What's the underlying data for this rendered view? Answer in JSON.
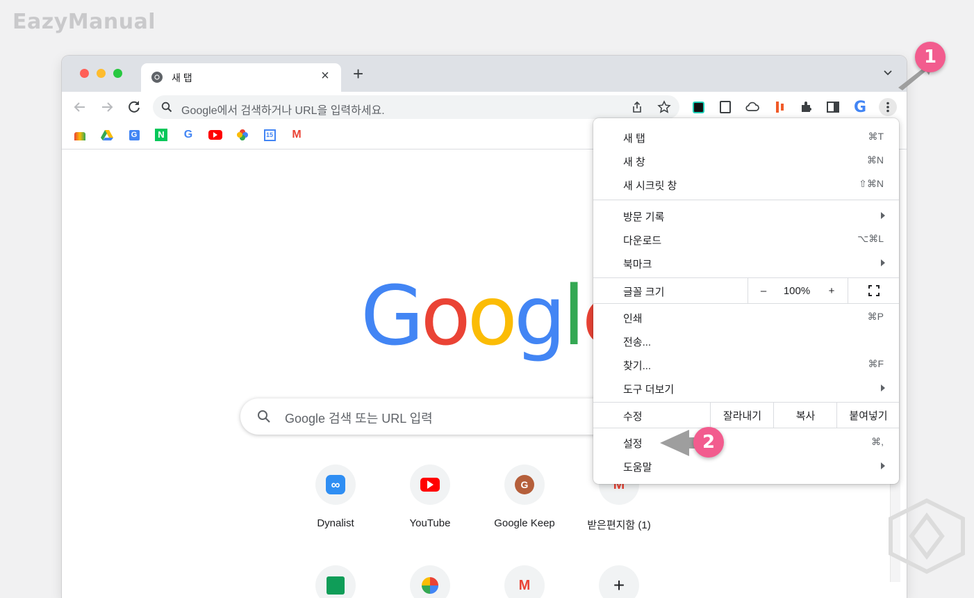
{
  "watermark": "EazyManual",
  "tab": {
    "title": "새 탭"
  },
  "omnibox": {
    "placeholder": "Google에서 검색하거나 URL을 입력하세요."
  },
  "page": {
    "logo": [
      "G",
      "o",
      "o",
      "g",
      "l",
      "e"
    ],
    "logo_colors": [
      "#4285f4",
      "#ea4335",
      "#fbbc05",
      "#4285f4",
      "#34a853",
      "#ea4335"
    ],
    "search_placeholder": "Google 검색 또는 URL 입력",
    "shortcuts": [
      {
        "label": "Dynalist",
        "icon": "dynalist-icon"
      },
      {
        "label": "YouTube",
        "icon": "youtube-icon"
      },
      {
        "label": "Google Keep",
        "icon": "keep-icon"
      },
      {
        "label": "받은편지함 (1)",
        "icon": "gmail-icon"
      }
    ]
  },
  "menu": {
    "new_tab": {
      "label": "새 탭",
      "shortcut": "⌘T"
    },
    "new_window": {
      "label": "새 창",
      "shortcut": "⌘N"
    },
    "incognito": {
      "label": "새 시크릿 창",
      "shortcut": "⇧⌘N"
    },
    "history": {
      "label": "방문 기록"
    },
    "downloads": {
      "label": "다운로드",
      "shortcut": "⌥⌘L"
    },
    "bookmarks": {
      "label": "북마크"
    },
    "zoom": {
      "label": "글꼴 크기",
      "minus": "–",
      "value": "100%",
      "plus": "+"
    },
    "print": {
      "label": "인쇄",
      "shortcut": "⌘P"
    },
    "cast": {
      "label": "전송..."
    },
    "find": {
      "label": "찾기...",
      "shortcut": "⌘F"
    },
    "more_tools": {
      "label": "도구 더보기"
    },
    "edit": {
      "label": "수정",
      "cut": "잘라내기",
      "copy": "복사",
      "paste": "붙여넣기"
    },
    "settings": {
      "label": "설정",
      "shortcut": "⌘,"
    },
    "help": {
      "label": "도움말"
    }
  },
  "annotations": {
    "badge1": "1",
    "badge2": "2"
  },
  "colors": {
    "badge": "#f25c8e",
    "arrow": "#9e9e9e"
  }
}
